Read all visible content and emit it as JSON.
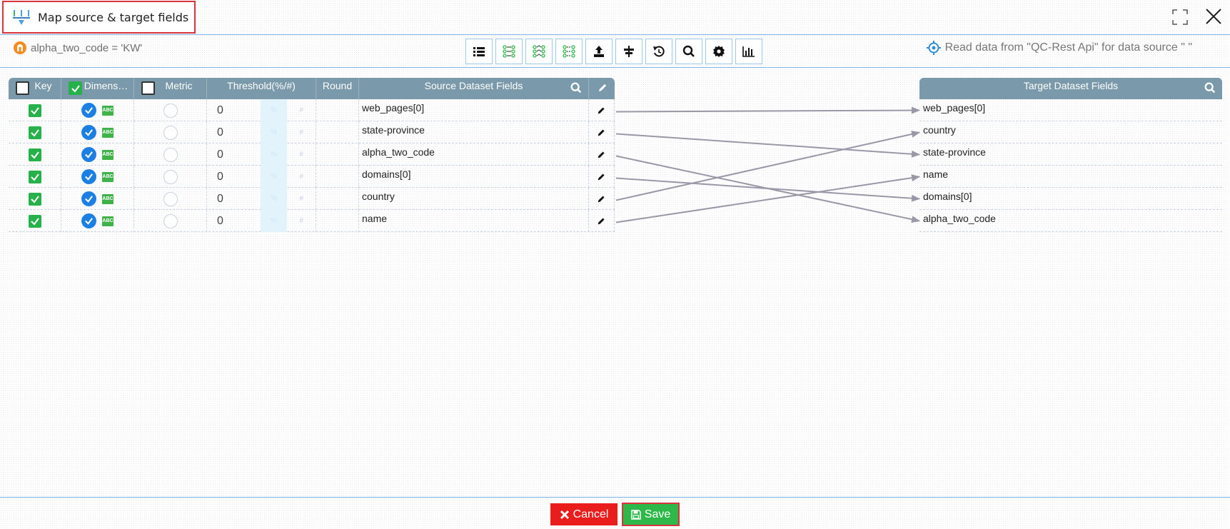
{
  "window": {
    "title": "Map source & target fields"
  },
  "toolbar": {
    "filter_text": "alpha_two_code = 'KW'",
    "datasource_text": "Read data from \"QC-Rest Api\" for data source \" \"",
    "tools": [
      {
        "icon": "list-icon"
      },
      {
        "icon": "map-all-icon"
      },
      {
        "icon": "map-by-name-icon"
      },
      {
        "icon": "map-by-order-icon"
      },
      {
        "icon": "upload-icon"
      },
      {
        "icon": "split-icon"
      },
      {
        "icon": "reset-icon"
      },
      {
        "icon": "search-icon"
      },
      {
        "icon": "settings-icon"
      },
      {
        "icon": "chart-icon"
      }
    ]
  },
  "source_table": {
    "headers": {
      "key": "Key",
      "dimension": "Dimens…",
      "metric": "Metric",
      "threshold": "Threshold(%/#)",
      "round": "Round",
      "source_fields": "Source Dataset Fields"
    },
    "rows": [
      {
        "key_checked": true,
        "dimension_selected": true,
        "threshold": "0",
        "toggle": "%",
        "hash": "#",
        "field": "web_pages[0]"
      },
      {
        "key_checked": true,
        "dimension_selected": true,
        "threshold": "0",
        "toggle": "%",
        "hash": "#",
        "field": "state-province"
      },
      {
        "key_checked": true,
        "dimension_selected": true,
        "threshold": "0",
        "toggle": "%",
        "hash": "#",
        "field": "alpha_two_code"
      },
      {
        "key_checked": true,
        "dimension_selected": true,
        "threshold": "0",
        "toggle": "%",
        "hash": "#",
        "field": "domains[0]"
      },
      {
        "key_checked": true,
        "dimension_selected": true,
        "threshold": "0",
        "toggle": "%",
        "hash": "#",
        "field": "country"
      },
      {
        "key_checked": true,
        "dimension_selected": true,
        "threshold": "0",
        "toggle": "%",
        "hash": "#",
        "field": "name"
      }
    ],
    "abc_badge": "ABC"
  },
  "target_table": {
    "header": "Target Dataset Fields",
    "rows": [
      {
        "field": "web_pages[0]"
      },
      {
        "field": "country"
      },
      {
        "field": "state-province"
      },
      {
        "field": "name"
      },
      {
        "field": "domains[0]"
      },
      {
        "field": "alpha_two_code"
      }
    ]
  },
  "mappings": [
    {
      "source": 0,
      "target": 0
    },
    {
      "source": 1,
      "target": 2
    },
    {
      "source": 2,
      "target": 5
    },
    {
      "source": 3,
      "target": 4
    },
    {
      "source": 4,
      "target": 1
    },
    {
      "source": 5,
      "target": 3
    }
  ],
  "footer": {
    "cancel_label": "Cancel",
    "save_label": "Save"
  },
  "colors": {
    "header_bg": "#7a99aa",
    "check_green": "#27b14a",
    "radio_blue": "#1c7fe3",
    "cancel_red": "#ea1d1d",
    "save_green": "#2fb84a",
    "connector": "#9a97a6"
  }
}
